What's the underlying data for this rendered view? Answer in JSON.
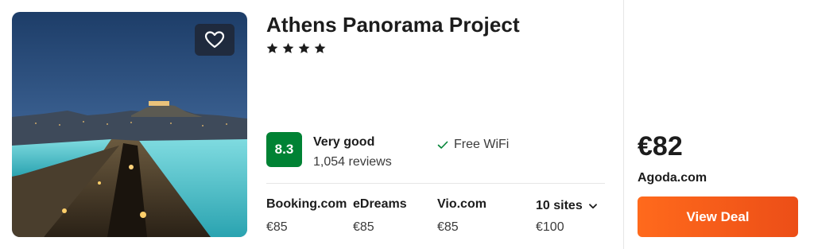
{
  "listing": {
    "title": "Athens Panorama Project",
    "star_rating": 4,
    "favorite_icon": "heart-icon",
    "rating": {
      "score": "8.3",
      "label": "Very good",
      "reviews": "1,054 reviews",
      "badge_color": "#008234"
    },
    "amenities": [
      {
        "icon": "check-icon",
        "label": "Free WiFi"
      }
    ],
    "sites": [
      {
        "name": "Booking.com",
        "price": "€85"
      },
      {
        "name": "eDreams",
        "price": "€85"
      },
      {
        "name": "Vio.com",
        "price": "€85"
      }
    ],
    "more_sites": {
      "label": "10 sites",
      "price": "€100",
      "icon": "chevron-down-icon"
    },
    "deal": {
      "price": "€82",
      "provider": "Agoda.com",
      "button_label": "View Deal",
      "button_color": "#ff6a1c"
    }
  }
}
